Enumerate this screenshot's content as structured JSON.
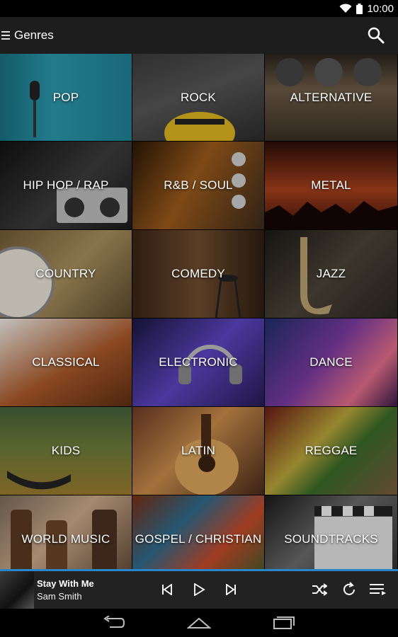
{
  "status_bar": {
    "time": "10:00",
    "wifi_icon": "wifi-icon",
    "battery_icon": "battery-icon"
  },
  "app_bar": {
    "title": "Genres",
    "menu_icon": "menu-icon",
    "search_icon": "search-icon"
  },
  "genres": [
    {
      "label": "POP",
      "bg": "linear-gradient(90deg,#1a6e80,#2a97aa 40%,#1f7f93)"
    },
    {
      "label": "ROCK",
      "bg": "linear-gradient(160deg,#3a3a3a,#555 45%,#2b2b2b)"
    },
    {
      "label": "ALTERNATIVE",
      "bg": "linear-gradient(180deg,#2a231c,#6b5a45 40%,#3a2f24)"
    },
    {
      "label": "HIP HOP / RAP",
      "bg": "linear-gradient(135deg,#111,#3c3c3c 55%,#1a1a1a)"
    },
    {
      "label": "R&B / SOUL",
      "bg": "linear-gradient(120deg,#2a1706,#9a5a1c 45%,#3b2a1b)"
    },
    {
      "label": "METAL",
      "bg": "linear-gradient(180deg,#2a0d08,#a5401c 55%,#3a120a)"
    },
    {
      "label": "COUNTRY",
      "bg": "linear-gradient(135deg,#6f5a34,#a78e5e 50%,#5a4a2a)"
    },
    {
      "label": "COMEDY",
      "bg": "linear-gradient(90deg,#3a2416,#6e4c2f 50%,#2e1d11)"
    },
    {
      "label": "JAZZ",
      "bg": "linear-gradient(135deg,#1b1a17,#4a4236 50%,#2a2622)"
    },
    {
      "label": "CLASSICAL",
      "bg": "linear-gradient(150deg,#eeeae4,#a8582a 55%,#5e2e12)"
    },
    {
      "label": "ELECTRONIC",
      "bg": "linear-gradient(135deg,#1b1640,#5b45c0 50%,#261b55)"
    },
    {
      "label": "DANCE",
      "bg": "linear-gradient(130deg,#1f2e6a,#7a3aa0 45%,#e16e8a 75%,#3a1a4a)"
    },
    {
      "label": "KIDS",
      "bg": "linear-gradient(180deg,#45603a,#6b7a3a 45%,#9a7a2e)"
    },
    {
      "label": "LATIN",
      "bg": "linear-gradient(135deg,#6a3a26,#c78a4a 45%,#4a2a1a)"
    },
    {
      "label": "REGGAE",
      "bg": "linear-gradient(135deg,#6a1a16,#b8a43a 40%,#3a6a2a 60%,#7a5a3a)"
    },
    {
      "label": "WORLD MUSIC",
      "bg": "linear-gradient(135deg,#7a6a5a,#caa98a 45%,#5a4332)"
    },
    {
      "label": "GOSPEL / CHRISTIAN",
      "bg": "linear-gradient(135deg,#7a2e14,#2e6a8a 35%,#c24a2a 65%,#3a5a2a)"
    },
    {
      "label": "SOUNDTRACKS",
      "bg": "linear-gradient(135deg,#1a1a1a,#6a6a6a 45%,#2a2a2a)"
    }
  ],
  "now_playing": {
    "song": "Stay With Me",
    "artist": "Sam Smith",
    "progress": 0.0
  },
  "player_controls": [
    "previous-icon",
    "play-icon",
    "next-icon",
    "shuffle-icon",
    "repeat-icon",
    "queue-icon"
  ],
  "nav_bar": [
    "back-icon",
    "home-icon",
    "recents-icon"
  ]
}
